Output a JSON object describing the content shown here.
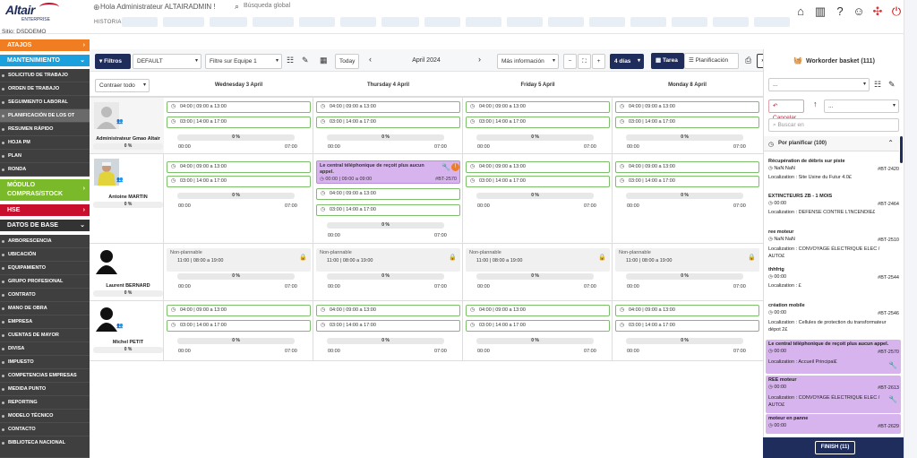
{
  "header": {
    "greeting": "Hola Administrateur ALTAIRADMIN !",
    "search_placeholder": "Búsqueda global",
    "history_label": "HISTORIA",
    "logo": "Altair",
    "logo_sub": "ENTERPRISE"
  },
  "sidebar": {
    "site": "Sitio: DSDDEMO",
    "sections": {
      "atajos": "ATAJOS",
      "mantenimiento": "MANTENIMIENTO",
      "compras": "MÓDULO COMPRAS/STOCK",
      "hse": "HSE",
      "datos": "DATOS DE BASE"
    },
    "maint_items": [
      "SOLICITUD DE TRABAJO",
      "ORDEN DE TRABAJO",
      "SEGUIMIENTO LABORAL",
      "PLANIFICACIÓN DE LOS OT",
      "RESUMEN RÁPIDO",
      "HOJA PM",
      "PLAN",
      "RONDA"
    ],
    "data_items": [
      "ARBORESCENCIA",
      "UBICACIÓN",
      "EQUIPAMIENTO",
      "GRUPO PROFESIONAL",
      "CONTRATO",
      "MANO DE OBRA",
      "EMPRESA",
      "CUENTAS DE MAYOR",
      "DIVISA",
      "IMPUESTO",
      "COMPETENCIAS EMPRESAS",
      "MEDIDA PUNTO",
      "REPORTING",
      "MODELO TÉCNICO",
      "CONTACTO",
      "BIBLIOTECA NACIONAL"
    ]
  },
  "toolbar": {
    "filters": "Filtros",
    "default": "DEFAULT",
    "team_filter": "Filtre sur Equipe 1",
    "today": "Today",
    "month": "April 2024",
    "more_info": "Más información",
    "days": "4 días",
    "task": "Tarea",
    "planning": "Planificación"
  },
  "grid": {
    "collapse_all": "Contraer todo",
    "days": [
      "Wednesday 3 April",
      "Thursday 4 April",
      "Friday 5 April",
      "Monday 8 April"
    ]
  },
  "resources": [
    {
      "name": "Administrateur Gmao Altair",
      "pct": "0 %"
    },
    {
      "name": "Antoine MARTIN",
      "pct": "0 %"
    },
    {
      "name": "Laurent BERNARD",
      "pct": "0 %"
    },
    {
      "name": "Michel PETIT",
      "pct": "0 %"
    }
  ],
  "slots": {
    "s1": "04:00 | 09:00 a 13:00",
    "s2": "03:00 | 14:00 a 17:00",
    "pct": "0 %",
    "t0": "00:00",
    "t1": "07:00",
    "np_title": "Non-plannable",
    "np_time": "11:00 | 08:00 a 19:00",
    "purple_title": "Le central téléphonique de reçoit plus aucun appel.",
    "purple_time": "00:00 | 09:00 a 09:00",
    "purple_ref": "#BT-2570"
  },
  "basket": {
    "title": "Workorder basket (111)",
    "select": "...",
    "cancel": "Cancelar",
    "sort": "...",
    "search": "Buscar en",
    "group": "Por planificar (100)",
    "finish": "FINISH (11)",
    "items": [
      {
        "title": "Récupération de débris sur piste",
        "sub": "NaN:NaN",
        "ref": "#BT-2420",
        "loc": "Localization : Site Usine du Futur 4.0£"
      },
      {
        "title": "EXTINCTEURS ZB - 1 MOIS",
        "sub": "00:00",
        "ref": "#BT-2464",
        "loc": "Localization : DEFENSE CONTRE L'INCENDIE£"
      },
      {
        "title": "ree moteur",
        "sub": "NaN:NaN",
        "ref": "#BT-2510",
        "loc": "Localization : CONVOYAGE ÉLECTRIQUE ELEC / AUTO£"
      },
      {
        "title": "thhfrtg",
        "sub": "00:00",
        "ref": "#BT-2544",
        "loc": "Localization : £"
      },
      {
        "title": "création mobile",
        "sub": "00:00",
        "ref": "#BT-2546",
        "loc": "Localization : Cellules de protection du transformateur dépot 2£"
      },
      {
        "title": "Le central téléphonique de reçoit plus aucun appel.",
        "sub": "00:00",
        "ref": "#BT-2570",
        "loc": "Localization : Accueil Principal£"
      },
      {
        "title": "REE moteur",
        "sub": "00:00",
        "ref": "#BT-2613",
        "loc": "Localization : CONVOYAGE ÉLECTRIQUE ELEC / AUTO£"
      },
      {
        "title": "moteur en panne",
        "sub": "00:00",
        "ref": "#BT-2629",
        "loc": ""
      }
    ]
  }
}
